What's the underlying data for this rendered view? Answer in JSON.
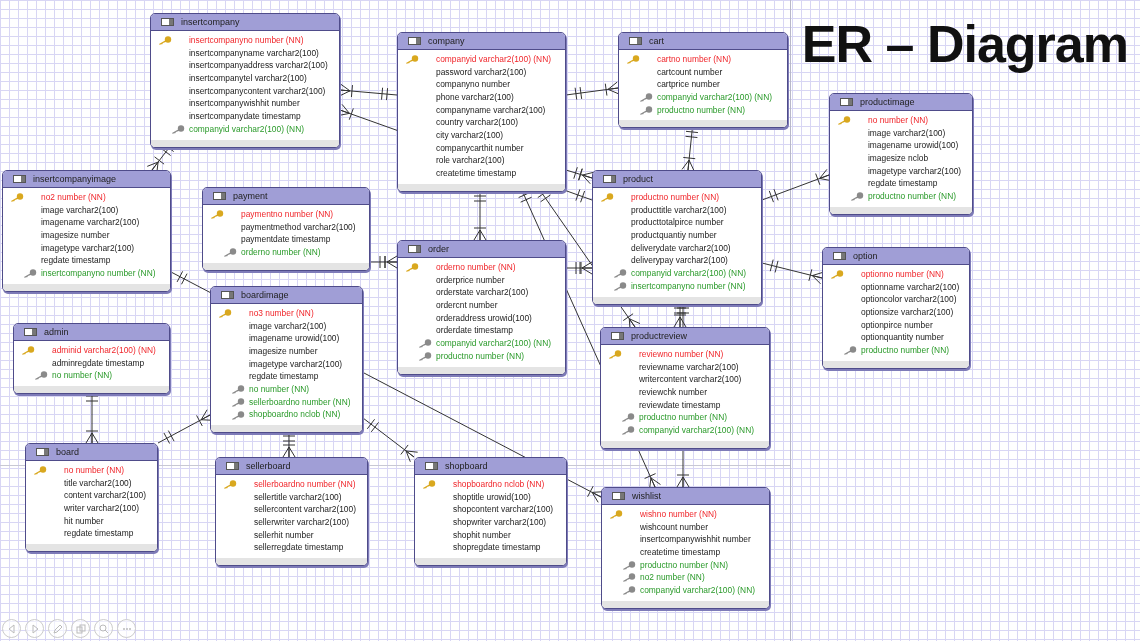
{
  "title": "ER – Diagram",
  "tables": [
    {
      "name": "insertcompany",
      "columns": [
        {
          "text": "insertcompanyno number (NN)",
          "kind": "pk"
        },
        {
          "text": "insertcompanyname varchar2(100)",
          "kind": "plain"
        },
        {
          "text": "insertcompanyaddress varchar2(100)",
          "kind": "plain"
        },
        {
          "text": "insertcompanytel varchar2(100)",
          "kind": "plain"
        },
        {
          "text": "insertcompanycontent varchar2(100)",
          "kind": "plain"
        },
        {
          "text": "insertcompanywishhit number",
          "kind": "plain"
        },
        {
          "text": "insertcompanydate timestamp",
          "kind": "plain"
        },
        {
          "text": "companyid varchar2(100) (NN)",
          "kind": "fk"
        }
      ]
    },
    {
      "name": "company",
      "columns": [
        {
          "text": "companyid varchar2(100) (NN)",
          "kind": "pk"
        },
        {
          "text": "password varchar2(100)",
          "kind": "plain"
        },
        {
          "text": "companyno number",
          "kind": "plain"
        },
        {
          "text": "phone varchar2(100)",
          "kind": "plain"
        },
        {
          "text": "companyname varchar2(100)",
          "kind": "plain"
        },
        {
          "text": "country varchar2(100)",
          "kind": "plain"
        },
        {
          "text": "city varchar2(100)",
          "kind": "plain"
        },
        {
          "text": "companycarthit number",
          "kind": "plain"
        },
        {
          "text": "role varchar2(100)",
          "kind": "plain"
        },
        {
          "text": "createtime timestamp",
          "kind": "plain"
        }
      ]
    },
    {
      "name": "cart",
      "columns": [
        {
          "text": "cartno number (NN)",
          "kind": "pk"
        },
        {
          "text": "cartcount number",
          "kind": "plain"
        },
        {
          "text": "cartprice number",
          "kind": "plain"
        },
        {
          "text": "companyid varchar2(100) (NN)",
          "kind": "fk"
        },
        {
          "text": "productno number (NN)",
          "kind": "fk"
        }
      ]
    },
    {
      "name": "productimage",
      "columns": [
        {
          "text": "no number (NN)",
          "kind": "pk"
        },
        {
          "text": "image varchar2(100)",
          "kind": "plain"
        },
        {
          "text": "imagename urowid(100)",
          "kind": "plain"
        },
        {
          "text": "imagesize nclob",
          "kind": "plain"
        },
        {
          "text": "imagetype varchar2(100)",
          "kind": "plain"
        },
        {
          "text": "regdate timestamp",
          "kind": "plain"
        },
        {
          "text": "productno number (NN)",
          "kind": "fk"
        }
      ]
    },
    {
      "name": "insertcompanyimage",
      "columns": [
        {
          "text": "no2 number (NN)",
          "kind": "pk"
        },
        {
          "text": "image varchar2(100)",
          "kind": "plain"
        },
        {
          "text": "imagename varchar2(100)",
          "kind": "plain"
        },
        {
          "text": "imagesize number",
          "kind": "plain"
        },
        {
          "text": "imagetype varchar2(100)",
          "kind": "plain"
        },
        {
          "text": "regdate timestamp",
          "kind": "plain"
        },
        {
          "text": "insertcompanyno number (NN)",
          "kind": "fk"
        }
      ]
    },
    {
      "name": "product",
      "columns": [
        {
          "text": "productno number (NN)",
          "kind": "pk"
        },
        {
          "text": "producttitle varchar2(100)",
          "kind": "plain"
        },
        {
          "text": "producttotalpirce number",
          "kind": "plain"
        },
        {
          "text": "productquantiy number",
          "kind": "plain"
        },
        {
          "text": "deliverydate varchar2(100)",
          "kind": "plain"
        },
        {
          "text": "deliverypay varchar2(100)",
          "kind": "plain"
        },
        {
          "text": "companyid varchar2(100) (NN)",
          "kind": "fk"
        },
        {
          "text": "insertcompanyno number (NN)",
          "kind": "fk"
        }
      ]
    },
    {
      "name": "payment",
      "columns": [
        {
          "text": "paymentno number (NN)",
          "kind": "pk"
        },
        {
          "text": "paymentmethod varchar2(100)",
          "kind": "plain"
        },
        {
          "text": "paymentdate timestamp",
          "kind": "plain"
        },
        {
          "text": "orderno number (NN)",
          "kind": "fk"
        }
      ]
    },
    {
      "name": "order",
      "columns": [
        {
          "text": "orderno number (NN)",
          "kind": "pk"
        },
        {
          "text": "orderprice number",
          "kind": "plain"
        },
        {
          "text": "orderstate varchar2(100)",
          "kind": "plain"
        },
        {
          "text": "ordercnt number",
          "kind": "plain"
        },
        {
          "text": "orderaddress urowid(100)",
          "kind": "plain"
        },
        {
          "text": "orderdate timestamp",
          "kind": "plain"
        },
        {
          "text": "companyid varchar2(100) (NN)",
          "kind": "fk"
        },
        {
          "text": "productno number (NN)",
          "kind": "fk"
        }
      ]
    },
    {
      "name": "option",
      "columns": [
        {
          "text": "optionno number (NN)",
          "kind": "pk"
        },
        {
          "text": "optionname varchar2(100)",
          "kind": "plain"
        },
        {
          "text": "optioncolor varchar2(100)",
          "kind": "plain"
        },
        {
          "text": "optionsize varchar2(100)",
          "kind": "plain"
        },
        {
          "text": "optionpirce number",
          "kind": "plain"
        },
        {
          "text": "optionquantity number",
          "kind": "plain"
        },
        {
          "text": "productno number (NN)",
          "kind": "fk"
        }
      ]
    },
    {
      "name": "admin",
      "columns": [
        {
          "text": "adminid varchar2(100) (NN)",
          "kind": "pk"
        },
        {
          "text": "adminregdate timestamp",
          "kind": "plain"
        },
        {
          "text": "no number (NN)",
          "kind": "fk"
        }
      ]
    },
    {
      "name": "boardimage",
      "columns": [
        {
          "text": "no3 number (NN)",
          "kind": "pk"
        },
        {
          "text": "image varchar2(100)",
          "kind": "plain"
        },
        {
          "text": "imagename urowid(100)",
          "kind": "plain"
        },
        {
          "text": "imagesize number",
          "kind": "plain"
        },
        {
          "text": "imagetype varchar2(100)",
          "kind": "plain"
        },
        {
          "text": "regdate timestamp",
          "kind": "plain"
        },
        {
          "text": "no number (NN)",
          "kind": "fk"
        },
        {
          "text": "sellerboardno number (NN)",
          "kind": "fk"
        },
        {
          "text": "shopboardno nclob (NN)",
          "kind": "fk"
        }
      ]
    },
    {
      "name": "productreview",
      "columns": [
        {
          "text": "reviewno number (NN)",
          "kind": "pk"
        },
        {
          "text": "reviewname varchar2(100)",
          "kind": "plain"
        },
        {
          "text": "writercontent varchar2(100)",
          "kind": "plain"
        },
        {
          "text": "reviewchk number",
          "kind": "plain"
        },
        {
          "text": "reviewdate timestamp",
          "kind": "plain"
        },
        {
          "text": "productno number (NN)",
          "kind": "fk"
        },
        {
          "text": "companyid varchar2(100) (NN)",
          "kind": "fk"
        }
      ]
    },
    {
      "name": "board",
      "columns": [
        {
          "text": "no number (NN)",
          "kind": "pk"
        },
        {
          "text": "title varchar2(100)",
          "kind": "plain"
        },
        {
          "text": "content varchar2(100)",
          "kind": "plain"
        },
        {
          "text": "writer varchar2(100)",
          "kind": "plain"
        },
        {
          "text": "hit number",
          "kind": "plain"
        },
        {
          "text": "regdate timestamp",
          "kind": "plain"
        }
      ]
    },
    {
      "name": "sellerboard",
      "columns": [
        {
          "text": "sellerboardno number (NN)",
          "kind": "pk"
        },
        {
          "text": "sellertitle varchar2(100)",
          "kind": "plain"
        },
        {
          "text": "sellercontent varchar2(100)",
          "kind": "plain"
        },
        {
          "text": "sellerwriter varchar2(100)",
          "kind": "plain"
        },
        {
          "text": "sellerhit number",
          "kind": "plain"
        },
        {
          "text": "sellerregdate timestamp",
          "kind": "plain"
        }
      ]
    },
    {
      "name": "shopboard",
      "columns": [
        {
          "text": "shopboardno nclob (NN)",
          "kind": "pk"
        },
        {
          "text": "shoptitle urowid(100)",
          "kind": "plain"
        },
        {
          "text": "shopcontent varchar2(100)",
          "kind": "plain"
        },
        {
          "text": "shopwriter varchar2(100)",
          "kind": "plain"
        },
        {
          "text": "shophit number",
          "kind": "plain"
        },
        {
          "text": "shopregdate timestamp",
          "kind": "plain"
        }
      ]
    },
    {
      "name": "wishlist",
      "columns": [
        {
          "text": "wishno number (NN)",
          "kind": "pk"
        },
        {
          "text": "wishcount number",
          "kind": "plain"
        },
        {
          "text": "insertcompanywishhit number",
          "kind": "plain"
        },
        {
          "text": "createtime timestamp",
          "kind": "plain"
        },
        {
          "text": "productno number (NN)",
          "kind": "fk"
        },
        {
          "text": "no2 number (NN)",
          "kind": "fk"
        },
        {
          "text": "companyid varchar2(100) (NN)",
          "kind": "fk"
        }
      ]
    }
  ]
}
